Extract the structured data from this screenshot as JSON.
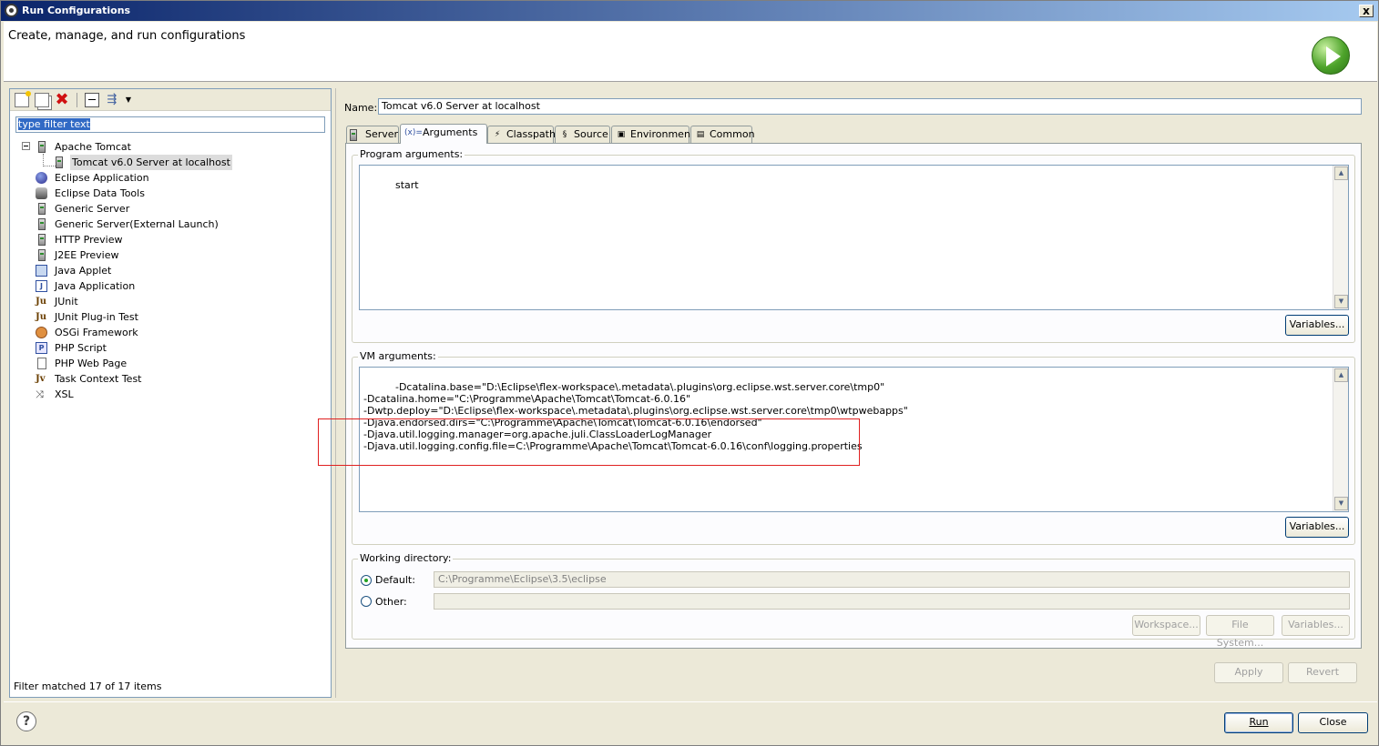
{
  "window": {
    "title": "Run Configurations",
    "header_title": "Create, manage, and run configurations",
    "close_glyph": "x"
  },
  "left": {
    "filter_placeholder": "type filter text",
    "tree": [
      {
        "label": "Apache Tomcat",
        "icon": "server-icon",
        "level": 0
      },
      {
        "label": "Tomcat v6.0 Server at localhost",
        "icon": "server-icon",
        "level": 1,
        "selected": true
      },
      {
        "label": "Eclipse Application",
        "icon": "eclipse-icon",
        "level": 0
      },
      {
        "label": "Eclipse Data Tools",
        "icon": "database-icon",
        "level": 0
      },
      {
        "label": "Generic Server",
        "icon": "server-icon",
        "level": 0
      },
      {
        "label": "Generic Server(External Launch)",
        "icon": "server-icon",
        "level": 0
      },
      {
        "label": "HTTP Preview",
        "icon": "server-icon",
        "level": 0
      },
      {
        "label": "J2EE Preview",
        "icon": "server-icon",
        "level": 0
      },
      {
        "label": "Java Applet",
        "icon": "applet-icon",
        "level": 0
      },
      {
        "label": "Java Application",
        "icon": "java-app-icon",
        "level": 0
      },
      {
        "label": "JUnit",
        "icon": "junit-icon",
        "level": 0
      },
      {
        "label": "JUnit Plug-in Test",
        "icon": "junit-plugin-icon",
        "level": 0
      },
      {
        "label": "OSGi Framework",
        "icon": "osgi-icon",
        "level": 0
      },
      {
        "label": "PHP Script",
        "icon": "php-script-icon",
        "level": 0
      },
      {
        "label": "PHP Web Page",
        "icon": "php-web-icon",
        "level": 0
      },
      {
        "label": "Task Context Test",
        "icon": "task-context-icon",
        "level": 0
      },
      {
        "label": "XSL",
        "icon": "xsl-icon",
        "level": 0
      }
    ],
    "filter_status": "Filter matched 17 of 17 items"
  },
  "right": {
    "name_label": "Name:",
    "name_value": "Tomcat v6.0 Server at localhost",
    "tabs": [
      {
        "label": "Server",
        "icon": "server-icon",
        "glyph": ""
      },
      {
        "label": "Arguments",
        "icon": "arguments-icon",
        "glyph": "(x)="
      },
      {
        "label": "Classpath",
        "icon": "classpath-icon",
        "glyph": "⚡"
      },
      {
        "label": "Source",
        "icon": "source-icon",
        "glyph": "§"
      },
      {
        "label": "Environment",
        "icon": "environment-icon",
        "glyph": "▣"
      },
      {
        "label": "Common",
        "icon": "common-icon",
        "glyph": "▤"
      }
    ],
    "program_args_label": "Program arguments:",
    "program_args_value": "start",
    "vm_args_label": "VM arguments:",
    "vm_args_value": "-Dcatalina.base=\"D:\\Eclipse\\flex-workspace\\.metadata\\.plugins\\org.eclipse.wst.server.core\\tmp0\"\n-Dcatalina.home=\"C:\\Programme\\Apache\\Tomcat\\Tomcat-6.0.16\"\n-Dwtp.deploy=\"D:\\Eclipse\\flex-workspace\\.metadata\\.plugins\\org.eclipse.wst.server.core\\tmp0\\wtpwebapps\"\n-Djava.endorsed.dirs=\"C:\\Programme\\Apache\\Tomcat\\Tomcat-6.0.16\\endorsed\"\n-Djava.util.logging.manager=org.apache.juli.ClassLoaderLogManager\n-Djava.util.logging.config.file=C:\\Programme\\Apache\\Tomcat\\Tomcat-6.0.16\\conf\\logging.properties",
    "variables_label": "Variables...",
    "working_dir_label": "Working directory:",
    "default_label": "Default:",
    "default_value": "C:\\Programme\\Eclipse\\3.5\\eclipse",
    "other_label": "Other:",
    "other_value": "",
    "workspace_label": "Workspace...",
    "filesystem_label": "File System...",
    "apply_label": "Apply",
    "revert_label": "Revert"
  },
  "footer": {
    "help_glyph": "?",
    "run_label": "Run",
    "close_label": "Close"
  }
}
